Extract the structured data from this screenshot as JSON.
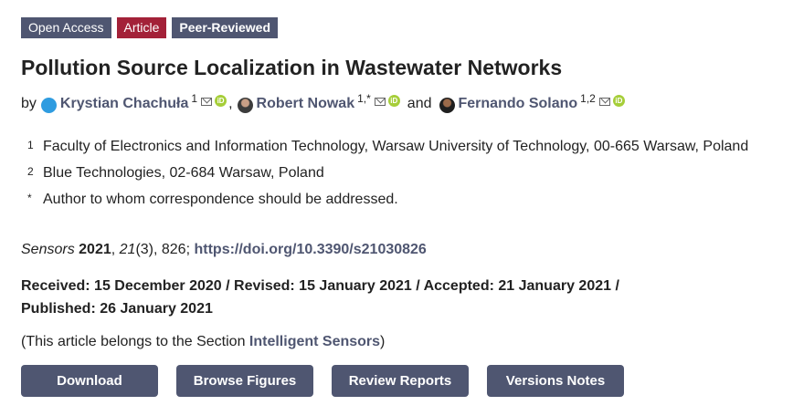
{
  "badges": {
    "open_access": "Open Access",
    "article": "Article",
    "peer_reviewed": "Peer-Reviewed"
  },
  "title": "Pollution Source Localization in Wastewater Networks",
  "authors": {
    "by": "by",
    "list": [
      {
        "name": "Krystian Chachuła",
        "affil": "1"
      },
      {
        "name": "Robert Nowak",
        "affil": "1,*"
      },
      {
        "name": "Fernando Solano",
        "affil": "1,2"
      }
    ],
    "comma": ",",
    "and": "and"
  },
  "affiliations": [
    {
      "marker": "1",
      "text": "Faculty of Electronics and Information Technology, Warsaw University of Technology, 00-665 Warsaw, Poland"
    },
    {
      "marker": "2",
      "text": "Blue Technologies, 02-684 Warsaw, Poland"
    },
    {
      "marker": "*",
      "text": "Author to whom correspondence should be addressed."
    }
  ],
  "citation": {
    "journal": "Sensors",
    "year": "2021",
    "volume": "21",
    "issue_pages": "(3), 826;",
    "doi": "https://doi.org/10.3390/s21030826"
  },
  "dates": {
    "line": "Received: 15 December 2020 / Revised: 15 January 2021 / Accepted: 21 January 2021 / Published: 26 January 2021"
  },
  "section": {
    "prefix": "(This article belongs to the Section ",
    "name": "Intelligent Sensors",
    "suffix": ")"
  },
  "buttons": {
    "download": "Download",
    "browse_figures": "Browse Figures",
    "review_reports": "Review Reports",
    "versions_notes": "Versions Notes"
  },
  "icons": {
    "orcid_glyph": "iD"
  },
  "colors": {
    "primary": "#4f5671",
    "article_badge": "#a32138",
    "orcid": "#a6ce39"
  }
}
